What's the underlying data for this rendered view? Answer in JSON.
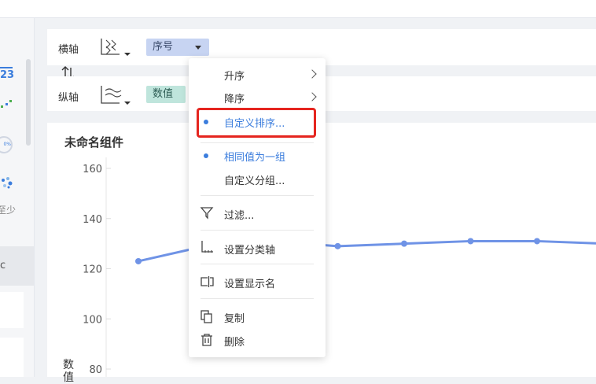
{
  "left_panel": {
    "badge": "23",
    "gauge_text": "0%",
    "cut_text": "至少",
    "tab_text": "c"
  },
  "toolbar": {
    "x_axis_label": "横轴",
    "x_field": "序号",
    "y_axis_label": "纵轴",
    "y_field": "数值",
    "swap_icon": "swap-vertical-icon"
  },
  "context_menu": {
    "items": [
      {
        "label": "升序",
        "has_submenu": true
      },
      {
        "label": "降序",
        "has_submenu": true
      },
      {
        "label": "自定义排序...",
        "selected": true,
        "highlighted": true
      },
      {
        "label": "相同值为一组",
        "selected": true
      },
      {
        "label": "自定义分组..."
      },
      {
        "label": "过滤...",
        "icon": "filter-icon"
      },
      {
        "label": "设置分类轴",
        "icon": "axis-icon"
      },
      {
        "label": "设置显示名",
        "icon": "rename-icon"
      },
      {
        "label": "复制",
        "icon": "copy-icon"
      },
      {
        "label": "删除",
        "icon": "delete-icon"
      }
    ],
    "highlight_color": "#e5251f",
    "accent_color": "#3b7ddd"
  },
  "chart_data": {
    "type": "line",
    "title": "未命名组件",
    "ylabel": "数值",
    "yticks": [
      160,
      140,
      120,
      100,
      80
    ],
    "ylim": [
      80,
      160
    ],
    "series": [
      {
        "values": [
          123,
          129,
          131,
          129,
          130,
          131,
          131,
          130
        ],
        "color": "#6f93e6"
      }
    ],
    "grid": false
  }
}
